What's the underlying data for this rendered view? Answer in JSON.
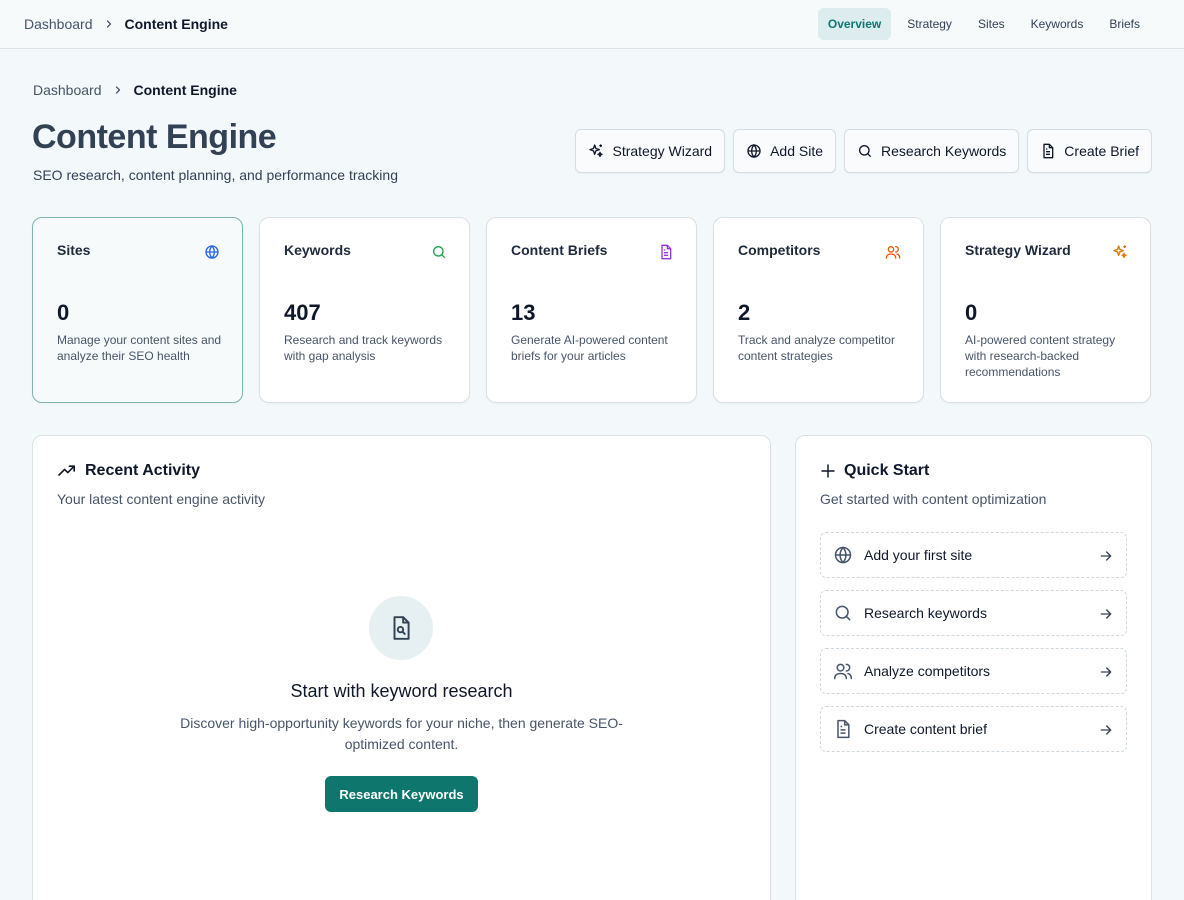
{
  "topbar": {
    "breadcrumb": [
      "Dashboard",
      "Content Engine"
    ],
    "tabs": [
      {
        "label": "Overview",
        "active": true
      },
      {
        "label": "Strategy",
        "active": false
      },
      {
        "label": "Sites",
        "active": false
      },
      {
        "label": "Keywords",
        "active": false
      },
      {
        "label": "Briefs",
        "active": false
      }
    ]
  },
  "page": {
    "breadcrumb": [
      "Dashboard",
      "Content Engine"
    ],
    "title": "Content Engine",
    "subtitle": "SEO research, content planning, and performance tracking",
    "actions": [
      {
        "label": "Strategy Wizard",
        "icon": "sparkles-icon"
      },
      {
        "label": "Add Site",
        "icon": "globe-icon"
      },
      {
        "label": "Research Keywords",
        "icon": "search-icon"
      },
      {
        "label": "Create Brief",
        "icon": "document-icon"
      }
    ]
  },
  "stats": [
    {
      "title": "Sites",
      "value": "0",
      "desc": "Manage your content sites and analyze their SEO health",
      "icon": "globe-icon",
      "color": "#2563eb"
    },
    {
      "title": "Keywords",
      "value": "407",
      "desc": "Research and track keywords with gap analysis",
      "icon": "search-icon",
      "color": "#16a34a"
    },
    {
      "title": "Content Briefs",
      "value": "13",
      "desc": "Generate AI-powered content briefs for your articles",
      "icon": "document-icon",
      "color": "#9333ea"
    },
    {
      "title": "Competitors",
      "value": "2",
      "desc": "Track and analyze competitor content strategies",
      "icon": "users-icon",
      "color": "#ea580c"
    },
    {
      "title": "Strategy Wizard",
      "value": "0",
      "desc": "AI-powered content strategy with research-backed recommendations",
      "icon": "sparkles-icon",
      "color": "#d97706"
    }
  ],
  "activity": {
    "title": "Recent Activity",
    "subtitle": "Your latest content engine activity",
    "empty_title": "Start with keyword research",
    "empty_desc": "Discover high-opportunity keywords for your niche, then generate SEO-optimized content.",
    "button": "Research Keywords"
  },
  "quick_start": {
    "title": "Quick Start",
    "subtitle": "Get started with content optimization",
    "items": [
      {
        "label": "Add your first site",
        "icon": "globe-icon"
      },
      {
        "label": "Research keywords",
        "icon": "search-icon"
      },
      {
        "label": "Analyze competitors",
        "icon": "users-icon"
      },
      {
        "label": "Create content brief",
        "icon": "document-icon"
      }
    ]
  },
  "colors": {
    "primary": "#0f766e",
    "active_tab_bg": "#dcecef",
    "page_bg": "#f3f8fa"
  }
}
